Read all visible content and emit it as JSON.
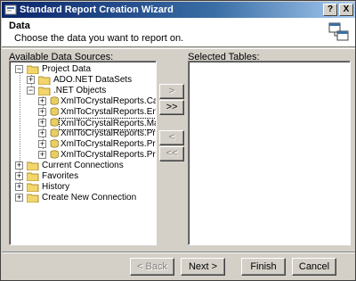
{
  "window": {
    "title": "Standard Report Creation Wizard",
    "help_label": "?",
    "close_label": "X"
  },
  "header": {
    "title": "Data",
    "subtitle": "Choose the data you want to report on."
  },
  "available": {
    "label": "Available Data Sources:",
    "tree": [
      {
        "label": "Project Data",
        "expander": "−"
      },
      {
        "label": "ADO.NET DataSets",
        "expander": "+"
      },
      {
        "label": ".NET Objects",
        "expander": "−"
      },
      {
        "label": "XmlToCrystalReports.CachedEm",
        "expander": "+"
      },
      {
        "label": "XmlToCrystalReports.Employee:",
        "expander": "+"
      },
      {
        "label": "XmlToCrystalReports.MainForm",
        "expander": "+"
      },
      {
        "label": "XmlToCrystalReports.Program",
        "expander": "+"
      },
      {
        "label": "XmlToCrystalReports.Properties",
        "expander": "+"
      },
      {
        "label": "XmlToCrystalReports.Properties",
        "expander": "+"
      },
      {
        "label": "Current Connections",
        "expander": "+"
      },
      {
        "label": "Favorites",
        "expander": "+"
      },
      {
        "label": "History",
        "expander": "+"
      },
      {
        "label": "Create New Connection",
        "expander": "+"
      }
    ]
  },
  "selected": {
    "label": "Selected Tables:"
  },
  "move_buttons": {
    "add": ">",
    "add_all": ">>",
    "remove": "<",
    "remove_all": "<<"
  },
  "footer": {
    "back": "< Back",
    "next": "Next >",
    "finish": "Finish",
    "cancel": "Cancel"
  }
}
